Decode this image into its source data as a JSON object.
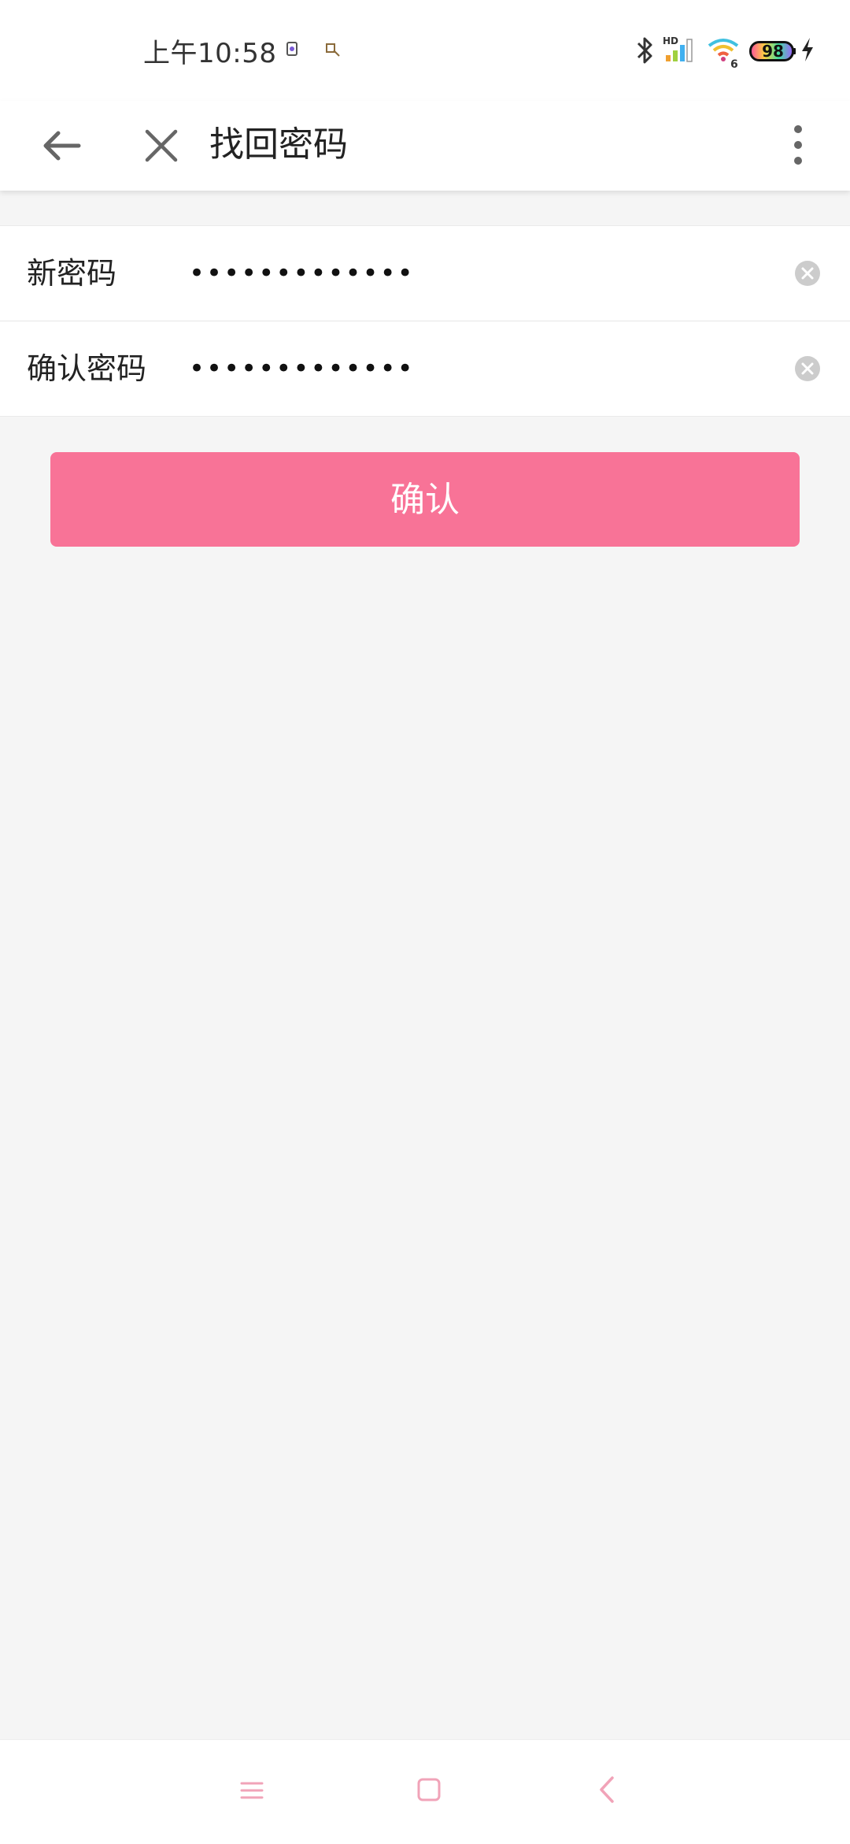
{
  "status_bar": {
    "time": "上午10:58",
    "battery_level": "98",
    "icons": [
      "notification-icon",
      "notification-icon",
      "bluetooth-icon",
      "hd-signal-icon",
      "wifi-6-icon",
      "battery-icon",
      "charging-icon"
    ]
  },
  "app_bar": {
    "title": "找回密码",
    "icons": [
      "arrow-left-icon",
      "close-icon",
      "more-vertical-icon"
    ]
  },
  "form": {
    "new_password": {
      "label": "新密码",
      "value": "•••••••••••••"
    },
    "confirm_password": {
      "label": "确认密码",
      "value": "•••••••••••••"
    }
  },
  "confirm_button": {
    "label": "确认"
  },
  "colors": {
    "accent": "#f87397",
    "background": "#f5f5f5",
    "surface": "#ffffff",
    "text": "#222222"
  },
  "nav_bar": {
    "icons": [
      "menu-icon",
      "home-icon",
      "back-icon"
    ]
  }
}
